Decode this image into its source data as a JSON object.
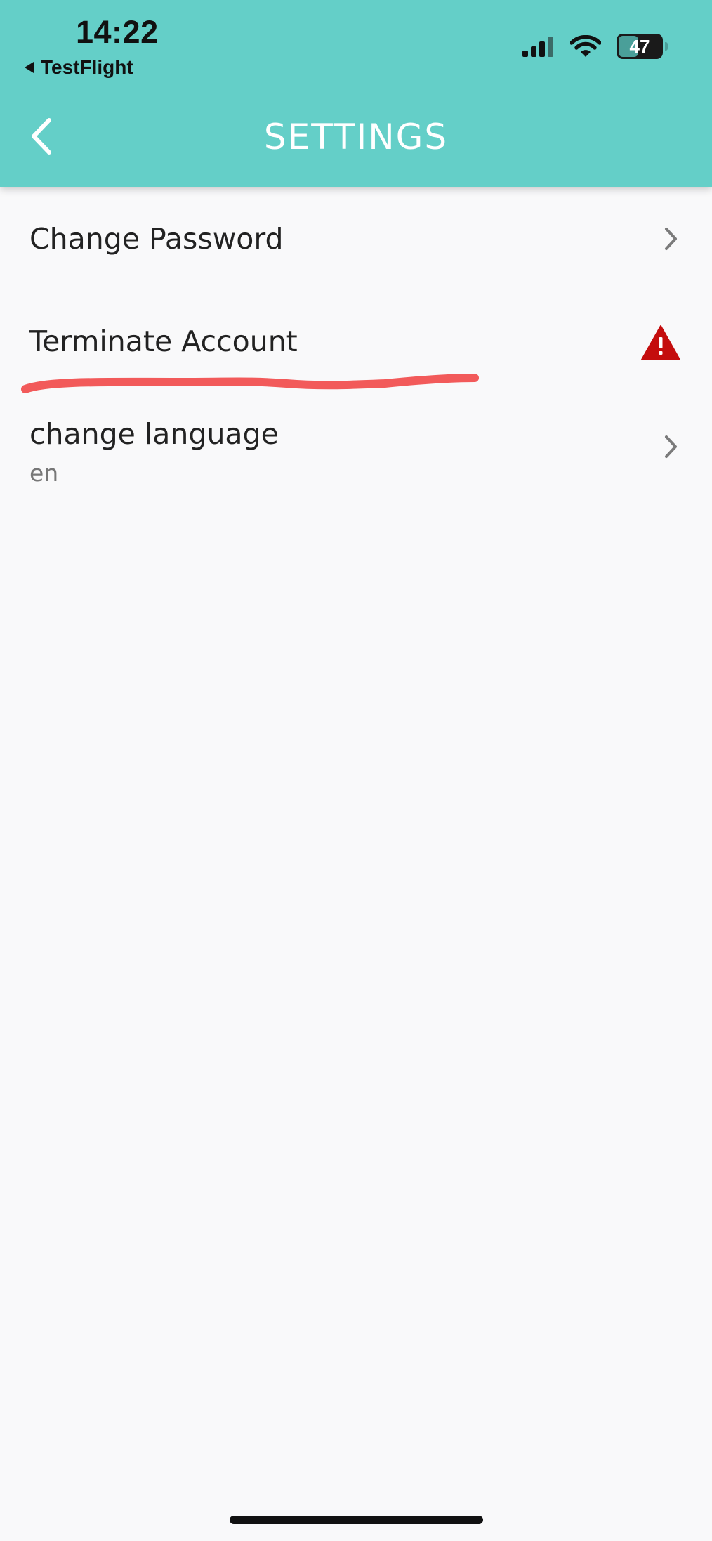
{
  "status_bar": {
    "time": "14:22",
    "back_app": "TestFlight",
    "battery": "47",
    "battery_level": 0.47,
    "icons": [
      "cellular-signal-icon",
      "wifi-icon",
      "battery-icon"
    ]
  },
  "nav": {
    "title": "SETTINGS",
    "back_icon": "chevron-left-icon"
  },
  "items": [
    {
      "label": "Change Password",
      "icon": "chevron-right-icon"
    },
    {
      "label": "Terminate Account",
      "icon": "warning-icon"
    },
    {
      "label": "change language",
      "value": "en",
      "icon": "chevron-right-icon"
    }
  ],
  "colors": {
    "header": "#64cfc8",
    "background": "#f9f9fa",
    "warning": "#c40d0d",
    "annotation": "#f25a5a"
  }
}
